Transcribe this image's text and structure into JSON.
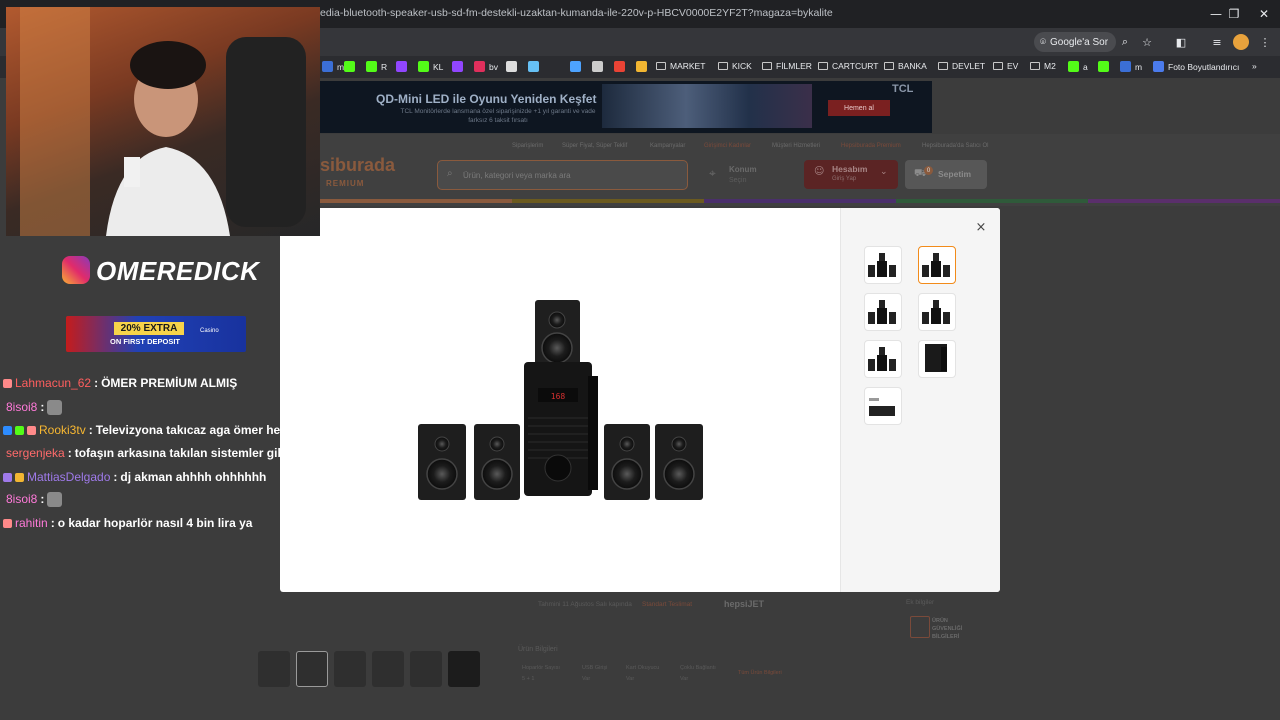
{
  "browser": {
    "url": "edia-bluetooth-speaker-usb-sd-fm-destekli-uzaktan-kumanda-ile-220v-p-HBCV0000E2YF2T?magaza=bykalite",
    "ask_google": "Google'a Sor",
    "window_controls": [
      "—",
      "❐",
      "✕"
    ],
    "bookmarks": [
      {
        "label": "m",
        "icon": "m-favicon",
        "color": "#3b6fd6"
      },
      {
        "label": "",
        "icon": "kick-favicon",
        "color": "#53fc18"
      },
      {
        "label": "R",
        "icon": "kick-favicon",
        "color": "#53fc18"
      },
      {
        "label": "",
        "icon": "twitch-favicon",
        "color": "#9146ff"
      },
      {
        "label": "KL",
        "icon": "kick-favicon",
        "color": "#53fc18"
      },
      {
        "label": "",
        "icon": "twitch-favicon",
        "color": "#9146ff"
      },
      {
        "label": "bv",
        "icon": "red-favicon",
        "color": "#e02f5c"
      },
      {
        "label": "",
        "icon": "chrome-favicon",
        "color": "#dddddd"
      },
      {
        "label": "",
        "icon": "steam-favicon",
        "color": "#66c0f4"
      },
      {
        "label": "",
        "icon": "map-favicon",
        "color": "#4da3ff"
      },
      {
        "label": "",
        "icon": "gear-favicon",
        "color": "#cccccc"
      },
      {
        "label": "",
        "icon": "google-favicon",
        "color": "#ea4335"
      },
      {
        "label": "",
        "icon": "yellow-favicon",
        "color": "#f2b632"
      }
    ],
    "folders": [
      "MARKET",
      "KICK",
      "FİLMLER",
      "CARTCURT",
      "BANKA",
      "DEVLET",
      "EV",
      "M2"
    ],
    "extra_bookmarks": [
      {
        "label": "a",
        "color": "#53fc18"
      },
      {
        "label": "",
        "color": "#53fc18"
      },
      {
        "label": "m",
        "color": "#3b6fd6"
      },
      {
        "label": "Foto Boyutlandırıcı",
        "color": "#4b7bec"
      }
    ],
    "more": "»"
  },
  "ad_banner": {
    "title": "QD-Mini LED ile Oyunu Yeniden Keşfet",
    "subtitle": "TCL Monitörlerde lansmana özel siparişinizde +1 yıl garanti ve vade farksız 6 taksit fırsatı",
    "cta": "Hemen al",
    "brand": "TCL"
  },
  "site_header": {
    "top_links": [
      "Siparişlerim",
      "Süper Fiyat, Süper Teklif",
      "Kampanyalar",
      "Girişimci Kadınlar",
      "Müşteri Hizmetleri",
      "Hepsiburada Premium",
      "Hepsiburada'da Satıcı Ol"
    ],
    "brand": "siburada",
    "brand_sub": "REMIUM",
    "search_placeholder": "Ürün, kategori veya marka ara",
    "location_title": "Konum",
    "location_sub": "Seçin",
    "account_title": "Hesabım",
    "account_sub": "Giriş Yap",
    "cart": "Sepetim",
    "cart_count": "0"
  },
  "page_bg_text": {
    "delivery": "Tahmini 11 Ağustos Salı kapında",
    "delivery_tag": "Standart Teslimat",
    "hepsijet": "hepsiJET",
    "extra_info": "Ek bilgiler",
    "safe_product": "ÜRÜN GÜVENLİĞİ BİLGİLERİ",
    "product_info_title": "Ürün Bilgileri",
    "specs": [
      {
        "label": "Hoparlör Sayısı",
        "value": "5 + 1"
      },
      {
        "label": "USB Girişi",
        "value": "Var"
      },
      {
        "label": "Kart Okuyucu",
        "value": "Var"
      },
      {
        "label": "Çoklu Bağlantı",
        "value": "Var"
      }
    ],
    "all_specs": "Tüm Ürün Bilgileri"
  },
  "modal": {
    "close": "×",
    "thumbnail_count": 7,
    "active_thumbnail": 2
  },
  "overlay": {
    "instagram_handle": "OMEREDICK",
    "promo_line1": "20% EXTRA",
    "promo_line2": "ON FIRST DEPOSIT",
    "promo_brand": "Casino",
    "chat": [
      {
        "user": "Lahmacun_62",
        "color": "#ff5e5e",
        "message": "ÖMER PREMİUM ALMIŞ",
        "badges": [
          "#ff8a8a"
        ]
      },
      {
        "user": "8isoi8",
        "color": "#ff7ad9",
        "message": "",
        "emote": true,
        "badges": []
      },
      {
        "user": "Rooki3tv",
        "color": "#f7b731",
        "message": "Televizyona takıcaz aga ömer hediye aldı",
        "badges": [
          "#2d8cff",
          "#53fc18",
          "#ff8a8a"
        ]
      },
      {
        "user": "sergenjeka",
        "color": "#ff6b6b",
        "message": "tofaşın arkasına takılan sistemler gibi",
        "badges": []
      },
      {
        "user": "MattiasDelgado",
        "color": "#9f7aea",
        "message": "dj akman ahhhh ohhhhhh",
        "badges": [
          "#9f7aea",
          "#f2b632"
        ]
      },
      {
        "user": "8isoi8",
        "color": "#ff7ad9",
        "message": "",
        "emote": true,
        "badges": []
      },
      {
        "user": "rahitin",
        "color": "#ff7ad9",
        "message": "o kadar hoparlör nasıl 4 bin lira ya",
        "badges": [
          "#ff8a8a"
        ]
      }
    ]
  },
  "colors": {
    "accent": "#f28b1a",
    "modal_bg": "#ffffff",
    "chrome_dark": "#202124"
  }
}
